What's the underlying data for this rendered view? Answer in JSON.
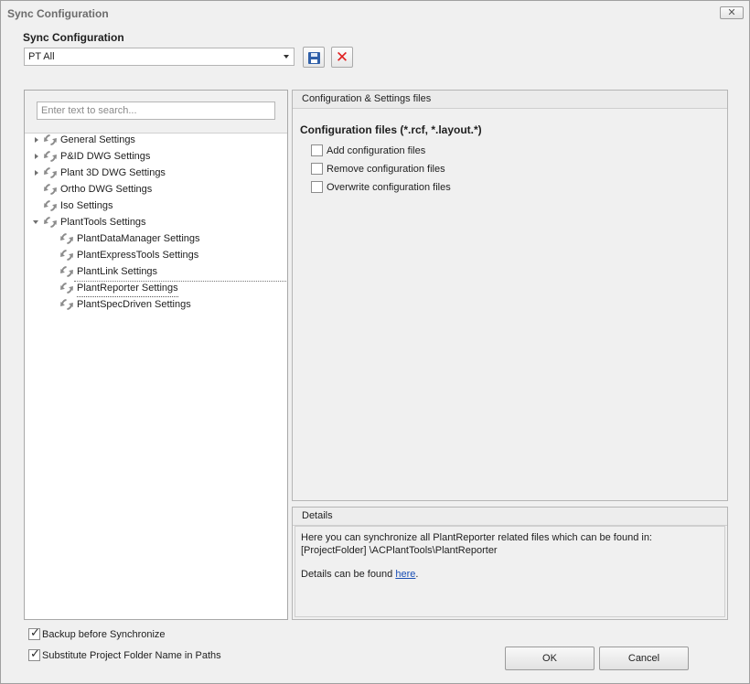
{
  "window": {
    "title": "Sync Configuration",
    "close_glyph": "✕"
  },
  "config": {
    "section_label": "Sync Configuration",
    "selected": "PT All"
  },
  "toolbar": {
    "save_icon": "floppy-disk-icon",
    "delete_icon": "red-x-icon",
    "delete_glyph": "✕"
  },
  "search": {
    "placeholder": "Enter text to search..."
  },
  "tree": {
    "items": [
      {
        "label": "General Settings",
        "level": 0,
        "expander": "collapsed"
      },
      {
        "label": "P&ID DWG Settings",
        "level": 0,
        "expander": "collapsed"
      },
      {
        "label": "Plant 3D DWG Settings",
        "level": 0,
        "expander": "collapsed"
      },
      {
        "label": "Ortho DWG Settings",
        "level": 0,
        "expander": "none"
      },
      {
        "label": "Iso Settings",
        "level": 0,
        "expander": "none"
      },
      {
        "label": "PlantTools Settings",
        "level": 0,
        "expander": "expanded"
      },
      {
        "label": "PlantDataManager Settings",
        "level": 1,
        "expander": "none"
      },
      {
        "label": "PlantExpressTools Settings",
        "level": 1,
        "expander": "none"
      },
      {
        "label": "PlantLink Settings",
        "level": 1,
        "expander": "none"
      },
      {
        "label": "PlantReporter Settings",
        "level": 1,
        "expander": "none",
        "selected": true
      },
      {
        "label": "PlantSpecDriven Settings",
        "level": 1,
        "expander": "none"
      }
    ]
  },
  "settings": {
    "header": "Configuration & Settings files",
    "group_title": "Configuration files (*.rcf, *.layout.*)",
    "options": [
      {
        "label": "Add configuration files",
        "checked": false
      },
      {
        "label": "Remove configuration files",
        "checked": false
      },
      {
        "label": "Overwrite configuration files",
        "checked": false
      }
    ]
  },
  "details": {
    "header": "Details",
    "line1": "Here you can synchronize all PlantReporter related files which can be found in:",
    "line2": "[ProjectFolder] \\ACPlantTools\\PlantReporter",
    "line3_prefix": "Details can be found ",
    "line3_link": "here",
    "line3_suffix": "."
  },
  "bottom": {
    "backup_label": "Backup before Synchronize",
    "backup_checked": true,
    "substitute_label": "Substitute Project Folder Name in Paths",
    "substitute_checked": true,
    "check_glyph": "✓",
    "ok_label": "OK",
    "cancel_label": "Cancel"
  }
}
